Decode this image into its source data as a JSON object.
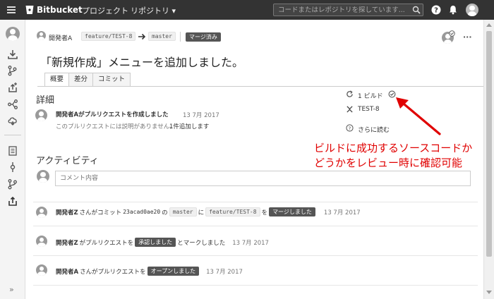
{
  "topbar": {
    "app_name": "Bitbucket",
    "nav": [
      "プロジェクト",
      "リポジトリ ▾"
    ],
    "search_placeholder": "コードまたはレポジトリを探しています..."
  },
  "pr_header": {
    "author": "開発者A",
    "source_branch": "feature/TEST-8",
    "target_branch": "master",
    "status": "マージ済み",
    "more": "···"
  },
  "title": "「新規作成」メニューを追加しました。",
  "tabs": [
    "概要",
    "差分",
    "コミット"
  ],
  "details": {
    "heading": "詳細",
    "created_text": "開発者Aがプルリクエストを作成しました",
    "created_date": "13 7月 2017",
    "no_description": "このプルリクエストには説明がありません。",
    "add_link": "1件追加します"
  },
  "sidebar_info": {
    "builds": "1 ビルド",
    "issue": "TEST-8",
    "read_more": "さらに読む"
  },
  "annotation": {
    "line1": "ビルドに成功するソースコードか",
    "line2": "どうかをレビュー時に確認可能"
  },
  "activity": {
    "heading": "アクティビティ",
    "comment_placeholder": "コメント内容",
    "items": [
      {
        "actor": "開発者Z",
        "prefix": "さんがコミット",
        "commit": "23acad0ae20",
        "mid1": "の",
        "branch1": "master",
        "mid2": "に",
        "branch2": "feature/TEST-8",
        "mid3": "を",
        "badge": "マージしました",
        "date": "13 7月 2017"
      },
      {
        "actor": "開発者Z",
        "prefix": "がプルリクエストを",
        "badge": "承認しました",
        "suffix": "とマークしました",
        "date": "13 7月 2017"
      },
      {
        "actor": "開発者A",
        "prefix": "さんがプルリクエストを",
        "badge": "オープンしました",
        "date": "13 7月 2017"
      }
    ]
  },
  "colors": {
    "topbar": "#333333",
    "annotation_red": "#e00000",
    "badge": "#555555",
    "sidebar": "#f4f4f4"
  },
  "expand_label": "»"
}
